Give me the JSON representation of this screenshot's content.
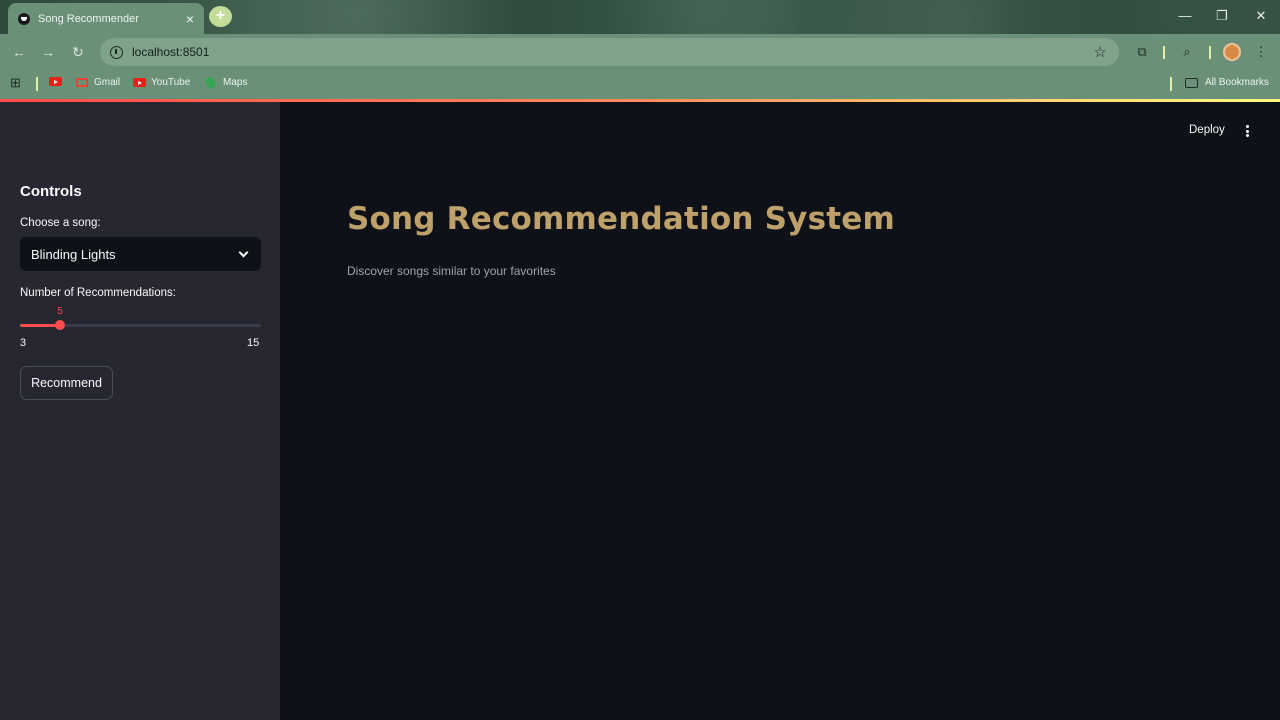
{
  "browser": {
    "tab_title": "Song Recommender",
    "tab_close": "×",
    "new_tab": "+",
    "url": "localhost:8501",
    "window_controls": {
      "minimize": "—",
      "restore": "❐",
      "close": "✕"
    },
    "nav": {
      "back": "←",
      "forward": "→",
      "reload": "↻",
      "star": "☆"
    },
    "bookmarks": {
      "apps": "⊞",
      "items": [
        {
          "label": "Gmail"
        },
        {
          "label": "YouTube"
        },
        {
          "label": "Maps"
        }
      ],
      "all": "All Bookmarks"
    },
    "accent_colors": [
      "#ff4b4b",
      "#fffd80"
    ]
  },
  "app": {
    "header": {
      "deploy_label": "Deploy"
    },
    "sidebar": {
      "title": "Controls",
      "song_label": "Choose a song:",
      "song_value": "Blinding Lights",
      "recs_label": "Number of Recommendations:",
      "slider": {
        "min": 3,
        "max": 15,
        "value": 5,
        "min_label": "3",
        "max_label": "15",
        "value_label": "5",
        "color": "#ff4b4b"
      },
      "button_label": "Recommend"
    },
    "main": {
      "title": "Song Recommendation System",
      "subtitle": "Discover songs similar to your favorites",
      "title_color": "#bda06a"
    }
  }
}
